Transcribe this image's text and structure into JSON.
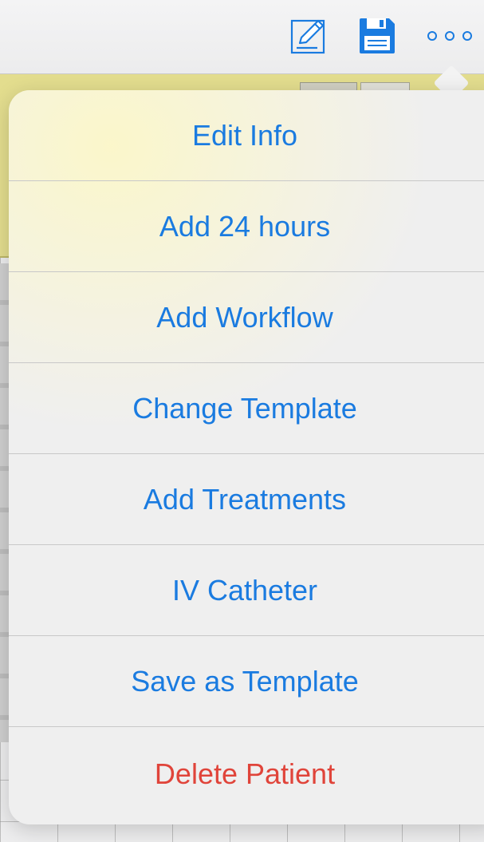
{
  "toolbar": {
    "icons": [
      "compose-icon",
      "save-icon",
      "more-icon"
    ],
    "accent_color": "#1a7be0"
  },
  "menu": {
    "items": [
      {
        "label": "Edit Info",
        "style": "default"
      },
      {
        "label": "Add 24 hours",
        "style": "default"
      },
      {
        "label": "Add Workflow",
        "style": "default"
      },
      {
        "label": "Change Template",
        "style": "default"
      },
      {
        "label": "Add Treatments",
        "style": "default"
      },
      {
        "label": "IV Catheter",
        "style": "default"
      },
      {
        "label": "Save as Template",
        "style": "default"
      },
      {
        "label": "Delete Patient",
        "style": "destructive"
      }
    ],
    "text_color": "#1a7be0",
    "destructive_color": "#e0443a"
  }
}
